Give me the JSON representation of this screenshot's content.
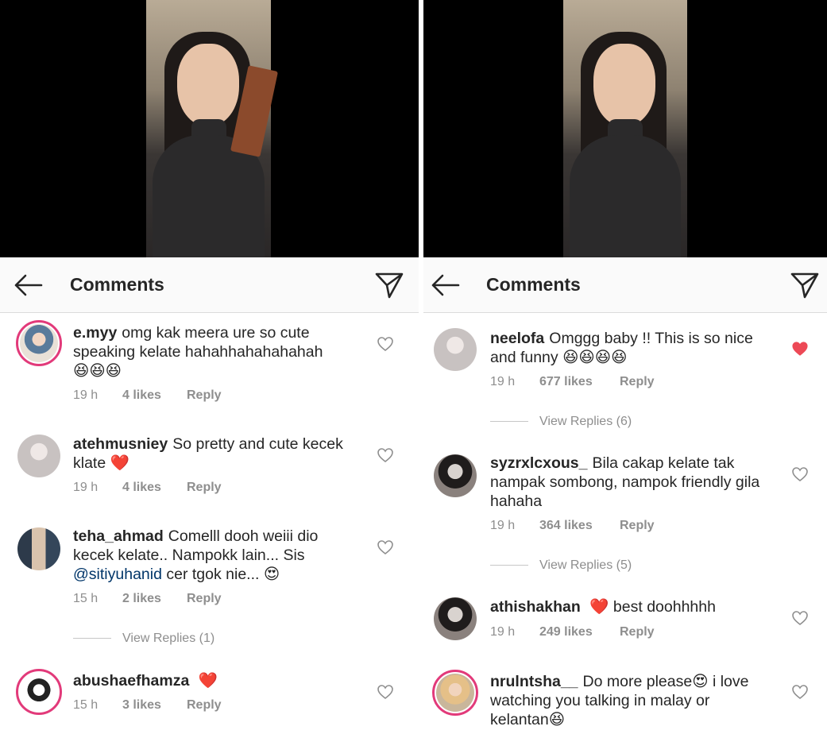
{
  "left": {
    "title": "Comments",
    "comments": [
      {
        "user": "e.myy",
        "text": "omg kak meera ure so cute speaking kelate hahahhahahahahah",
        "emoji": "😆😆😆",
        "time": "19 h",
        "likes": "4 likes",
        "reply": "Reply"
      },
      {
        "user": "atehmusniey",
        "text": "So pretty and cute kecek klate",
        "emoji": "❤️",
        "time": "19 h",
        "likes": "4 likes",
        "reply": "Reply"
      },
      {
        "user": "teha_ahmad",
        "text_a": "Comelll dooh weiii dio kecek kelate.. Nampokk lain... Sis",
        "mention": "@sitiyuhanid",
        "text_b": "cer tgok nie...",
        "emoji": "😍",
        "time": "15 h",
        "likes": "2 likes",
        "reply": "Reply",
        "view_replies": "View Replies (1)"
      },
      {
        "user": "abushaefhamza",
        "emoji": "❤️",
        "time": "15 h",
        "likes": "3 likes",
        "reply": "Reply"
      }
    ]
  },
  "right": {
    "title": "Comments",
    "comments": [
      {
        "user": "neelofa",
        "text": "Omggg baby !! This is so nice and funny",
        "emoji": "😆😆😆😆",
        "time": "19 h",
        "likes": "677 likes",
        "reply": "Reply",
        "view_replies": "View Replies (6)",
        "liked": true
      },
      {
        "user": "syzrxlcxous_",
        "text": "Bila cakap kelate tak nampak sombong, nampok friendly gila hahaha",
        "time": "19 h",
        "likes": "364 likes",
        "reply": "Reply",
        "view_replies": "View Replies (5)"
      },
      {
        "user": "athishakhan",
        "emoji": "❤️",
        "text": "best doohhhhh",
        "time": "19 h",
        "likes": "249 likes",
        "reply": "Reply"
      },
      {
        "user": "nrulntsha__",
        "text_a": "Do more please",
        "emoji_a": "😍",
        "text_b": "i love watching you talking in malay or kelantan",
        "emoji_b": "😆"
      }
    ]
  },
  "colors": {
    "liked_heart": "#ed4956",
    "ring": "#e23a7a",
    "mention": "#003569"
  }
}
